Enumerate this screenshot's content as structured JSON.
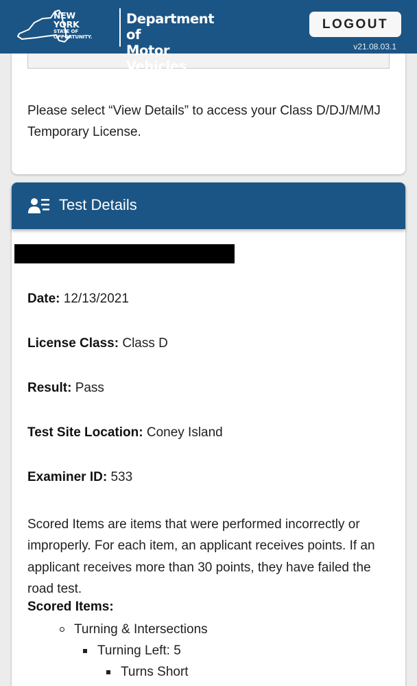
{
  "header": {
    "logo_line1": "NEW YORK",
    "logo_line2": "STATE OF",
    "logo_line3": "OPPORTUNITY.",
    "dept_line1": "Department of",
    "dept_line2": "Motor Vehicles",
    "logout_label": "LOGOUT",
    "version": "v21.08.03.1"
  },
  "license_card": {
    "message": "Please select “View Details” to access your Class D/DJ/M/MJ Temporary License."
  },
  "test_details": {
    "title": "Test Details",
    "fields": [
      {
        "label": "Date:",
        "value": "12/13/2021"
      },
      {
        "label": "License Class:",
        "value": "Class D"
      },
      {
        "label": "Result:",
        "value": "Pass"
      },
      {
        "label": "Test Site Location:",
        "value": "Coney Island"
      },
      {
        "label": "Examiner ID:",
        "value": "533"
      }
    ],
    "description": "Scored Items are items that were performed incorrectly or improperly. For each item, an applicant receives points. If an applicant receives more than 30 points, they have failed the road test.",
    "scored_items_label": "Scored Items:",
    "scored_items": {
      "category": "Turning & Intersections",
      "subcategory": "Turning Left: 5",
      "detail": "Turns Short"
    }
  },
  "colors": {
    "header_blue": "#1b5585",
    "page_background": "#ececec"
  }
}
